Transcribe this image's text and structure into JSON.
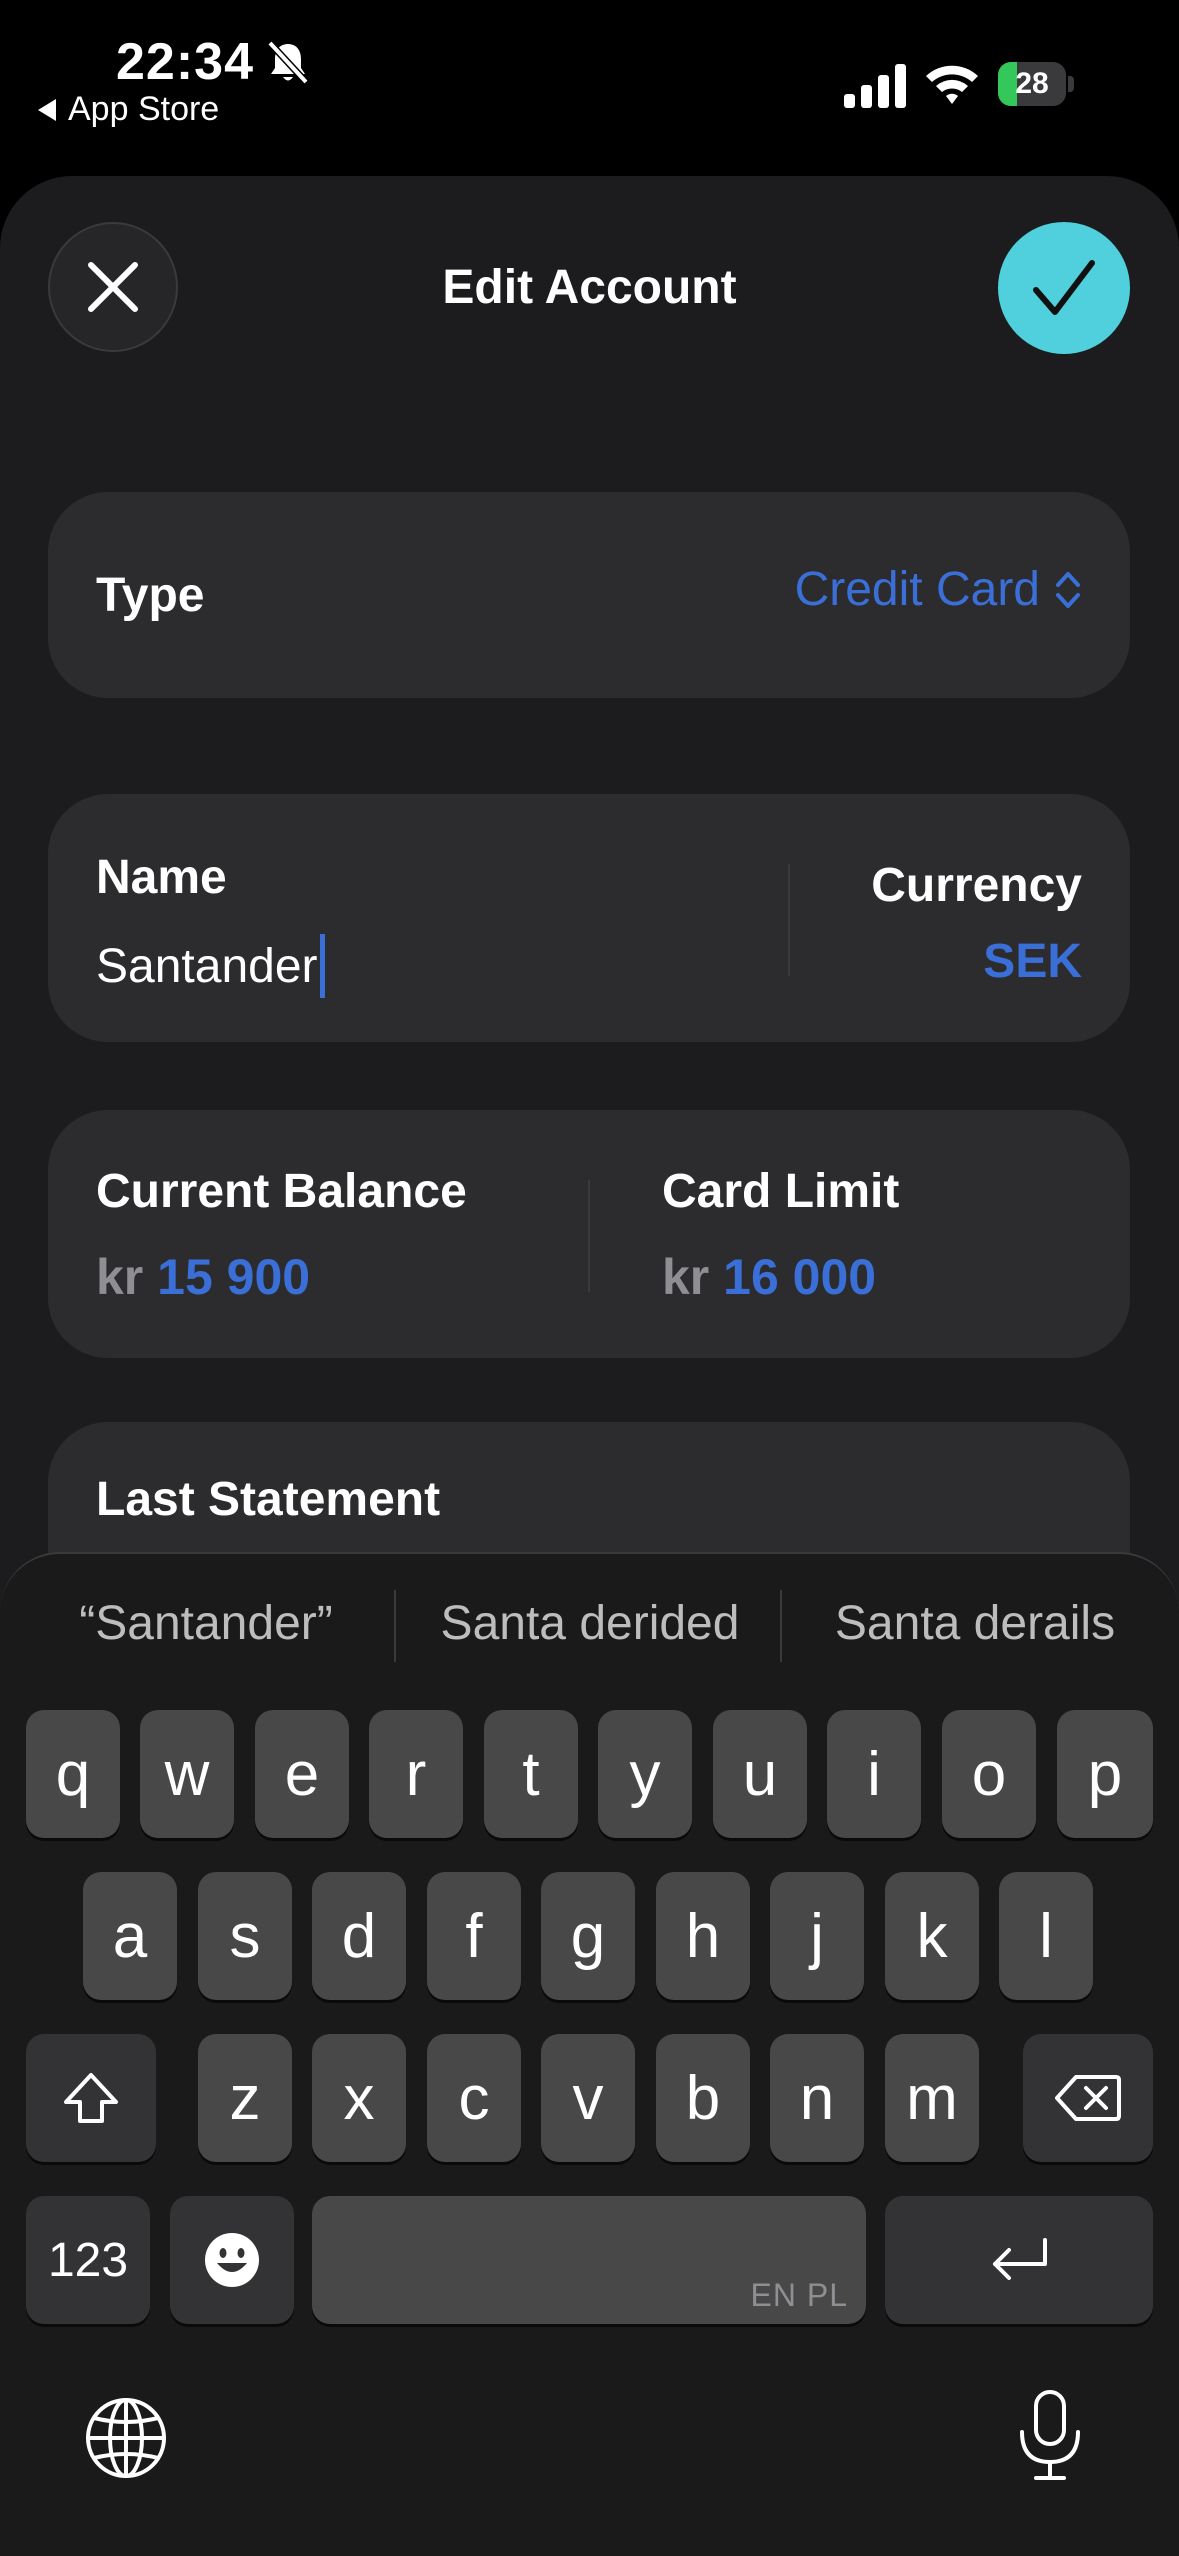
{
  "status_bar": {
    "time": "22:34",
    "back_label": "App Store",
    "battery_level": 28,
    "battery_text": "28"
  },
  "header": {
    "title": "Edit Account",
    "accent": "#4fd0dc"
  },
  "type_row": {
    "label": "Type",
    "value": "Credit Card"
  },
  "name_row": {
    "name_label": "Name",
    "name_value": "Santander",
    "currency_label": "Currency",
    "currency_value": "SEK"
  },
  "balance_row": {
    "current_balance_label": "Current Balance",
    "current_balance_currency": "kr",
    "current_balance_value": "15 900",
    "card_limit_label": "Card Limit",
    "card_limit_currency": "kr",
    "card_limit_value": "16 000"
  },
  "statement_row": {
    "label": "Last Statement"
  },
  "keyboard": {
    "suggestions": [
      "“Santander”",
      "Santa derided",
      "Santa derails"
    ],
    "row1": [
      "q",
      "w",
      "e",
      "r",
      "t",
      "y",
      "u",
      "i",
      "o",
      "p"
    ],
    "row2": [
      "a",
      "s",
      "d",
      "f",
      "g",
      "h",
      "j",
      "k",
      "l"
    ],
    "row3": [
      "z",
      "x",
      "c",
      "v",
      "b",
      "n",
      "m"
    ],
    "numbers_key": "123",
    "space_languages": "EN PL"
  },
  "colors": {
    "link_blue": "#3a6fd8",
    "battery_green": "#34c759"
  }
}
